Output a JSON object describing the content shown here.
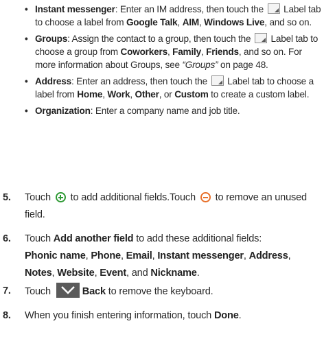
{
  "bullets": {
    "im": {
      "term": "Instant messenger",
      "text1": ": Enter an IM address, then touch the ",
      "text2": " Label tab to choose a label from ",
      "opt1": "Google Talk",
      "sep1": ", ",
      "opt2": "AIM",
      "sep2": ", ",
      "opt3": "Windows Live",
      "tail": ", and so on."
    },
    "groups": {
      "term": "Groups",
      "text1": ": Assign the contact to a group, then touch the ",
      "text2": " Label tab to choose a group from ",
      "opt1": "Coworkers",
      "sep1": ", ",
      "opt2": "Family",
      "sep2": ", ",
      "opt3": "Friends",
      "mid": ", and so on. For more information about Groups, see ",
      "ref": "“Groups”",
      "tail": " on page 48."
    },
    "address": {
      "term": "Address",
      "text1": ": Enter an address, then touch the ",
      "text2": " Label tab to choose a label from ",
      "opt1": "Home",
      "sep1": ", ",
      "opt2": "Work",
      "sep2": ", ",
      "opt3": "Other",
      "sep3": ", or ",
      "opt4": "Custom",
      "tail": " to create a custom label."
    },
    "organization": {
      "term": "Organization",
      "text": ": Enter a company name and job title."
    }
  },
  "steps": {
    "s5": {
      "num": "5.",
      "pre": "Touch ",
      "mid": " to add additional fields.Touch ",
      "post": " to remove an unused field."
    },
    "s6": {
      "num": "6.",
      "pre": "Touch ",
      "action": "Add another field",
      "mid": " to add these additional fields:",
      "fields": [
        "Phonic name",
        "Phone",
        "Email",
        "Instant messenger",
        "Address",
        "Notes",
        "Website",
        "Event",
        "Nickname"
      ],
      "sep": ", ",
      "last_sep": ", and ",
      "end": "."
    },
    "s7": {
      "num": "7.",
      "pre": "Touch ",
      "action": "Back",
      "post": " to remove the keyboard."
    },
    "s8": {
      "num": "8.",
      "pre": "When you finish entering information, touch ",
      "action": "Done",
      "end": "."
    }
  },
  "icons": {
    "label_tab": "label-tab-icon",
    "add_field": "plus-circle-icon",
    "remove_field": "minus-circle-icon",
    "back": "keyboard-back-icon"
  },
  "colors": {
    "add_green": "#2f9a35",
    "remove_orange": "#e8702a",
    "back_button": "#5a5a5a"
  }
}
